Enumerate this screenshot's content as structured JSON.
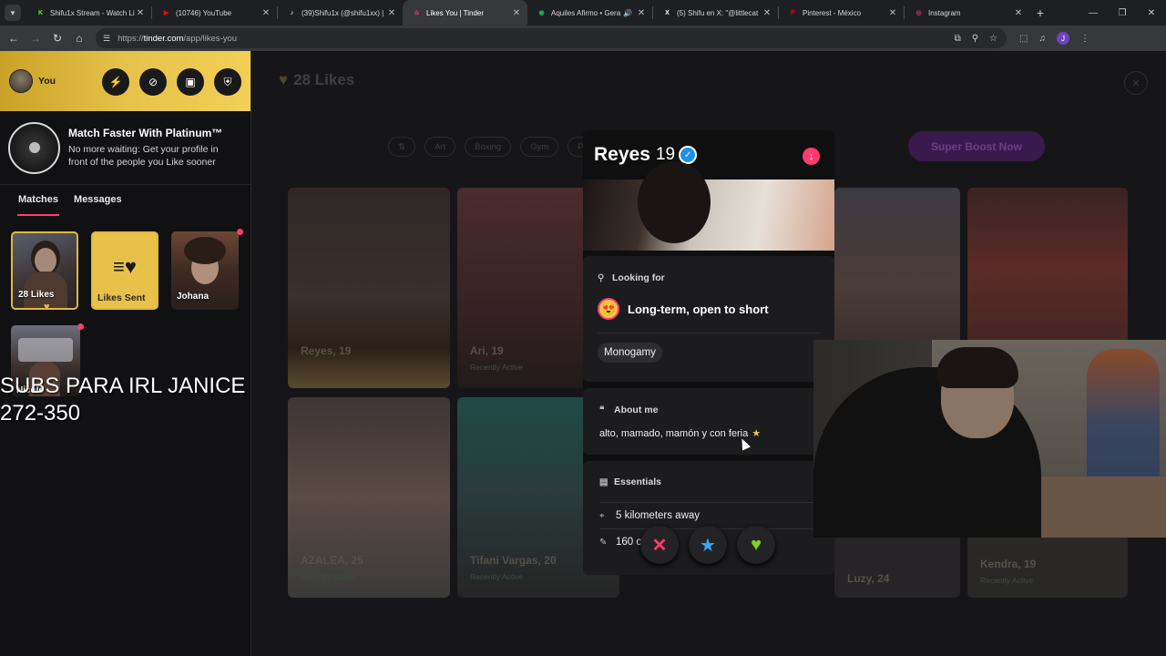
{
  "browser": {
    "tabs": [
      {
        "title": "Shifu1x Stream - Watch Li",
        "favicon": "kick-icon",
        "color": "#53fc18",
        "active": false,
        "audio": false
      },
      {
        "title": "(10746) YouTube",
        "favicon": "youtube-icon",
        "color": "#ff0000",
        "active": false,
        "audio": false
      },
      {
        "title": "(39)Shifu1x (@shifu1xx) |",
        "favicon": "tiktok-icon",
        "color": "#ffffff",
        "active": false,
        "audio": false
      },
      {
        "title": "Likes You | Tinder",
        "favicon": "tinder-icon",
        "color": "#fe3c72",
        "active": true,
        "audio": false
      },
      {
        "title": "Aquiles Afirmo • Gera",
        "favicon": "spotify-icon",
        "color": "#1db954",
        "active": false,
        "audio": true
      },
      {
        "title": "(5) Shifu en X: \"@littlecat",
        "favicon": "x-icon",
        "color": "#ffffff",
        "active": false,
        "audio": false
      },
      {
        "title": "Pinterest - México",
        "favicon": "pinterest-icon",
        "color": "#e60023",
        "active": false,
        "audio": false
      },
      {
        "title": "Instagram",
        "favicon": "instagram-icon",
        "color": "#e1306c",
        "active": false,
        "audio": false
      }
    ],
    "url_scheme": "https://",
    "url_host": "tinder.com",
    "url_path": "/app/likes-you",
    "profile_initial": "J"
  },
  "sidebar": {
    "user_label": "You",
    "platinum_title": "Match Faster With Platinum™",
    "platinum_desc": "No more waiting: Get your profile in front of the people you Like sooner",
    "tabs": [
      "Matches",
      "Messages"
    ],
    "likes_label": "28 Likes",
    "likes_sent_label": "Likes Sent",
    "matches": [
      {
        "name": "Johana",
        "unread": true
      },
      {
        "name": "Nicole",
        "unread": true
      }
    ]
  },
  "overlay": {
    "line1": "SUBS PARA IRL JANICE",
    "line2": "272-350"
  },
  "main": {
    "title": "28 Likes",
    "filters": [
      "Art",
      "Boxing",
      "Gym",
      "Poli"
    ],
    "super_boost_label": "Super Boost Now",
    "cards": [
      {
        "name": "Reyes, 19",
        "active": ""
      },
      {
        "name": "Ari, 19",
        "active": "Recently Active"
      },
      {
        "name": "AZALEA, 25",
        "active": "Recently Active"
      },
      {
        "name": "Tifani Vargas, 20",
        "active": "Recently Active"
      },
      {
        "name": "Luzy, 24",
        "active": ""
      },
      {
        "name": "Kendra, 19",
        "active": "Recently Active"
      }
    ]
  },
  "profile": {
    "name": "Reyes",
    "age": "19",
    "looking_for_label": "Looking for",
    "looking_for_value": "Long-term, open to short",
    "relationship_type": "Monogamy",
    "about_label": "About me",
    "about_text": "alto, mamado, mamón y con feria",
    "essentials_label": "Essentials",
    "distance": "5 kilometers away",
    "height_partial": "160 c"
  },
  "colors": {
    "tinder_pink": "#fe3c72",
    "gold": "#e7c24a",
    "verified_blue": "#1e8fe8",
    "like_green": "#7ed321",
    "super_like_blue": "#3ba6f5"
  }
}
